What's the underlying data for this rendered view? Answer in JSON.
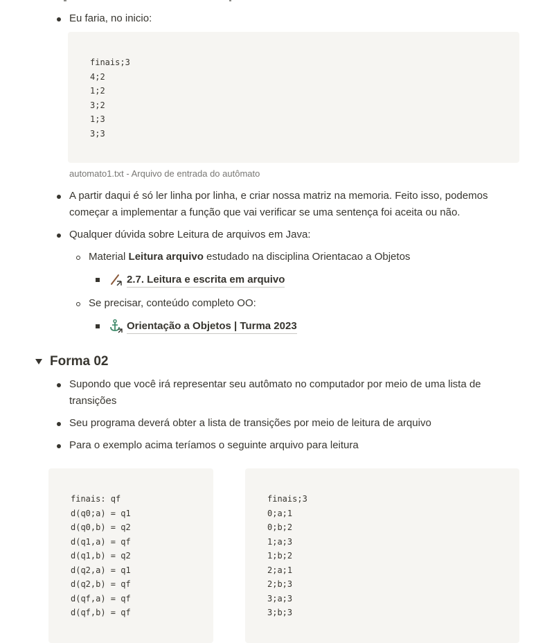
{
  "top_list": {
    "item1": "Eu faria, no inicio:",
    "code1": [
      "finais;3",
      "4;2",
      "1;2",
      "3;2",
      "1;3",
      "3;3"
    ],
    "caption": "automato1.txt - Arquivo de entrada do autômato",
    "item2_line1": "A partir daqui é só ler linha por linha, e criar nossa matriz na memoria. Feito isso, podemos",
    "item2_line2": "começar a implementar a função que vai verificar se uma sentença foi aceita ou não.",
    "item3": "Qualquer dúvida sobre Leitura de arquivos em Java:",
    "sub1_pre": "Material ",
    "sub1_bold": "Leitura arquivo",
    "sub1_post": " estudado na disciplina Orientacao a Objetos",
    "link1": "2.7. Leitura e escrita em arquivo",
    "sub2": "Se precisar, conteúdo completo OO:",
    "link2": "Orientação a Objetos | Turma 2023"
  },
  "section": {
    "title": "Forma 02",
    "item1_line1": "Supondo que você irá representar seu autômato no computador por meio de uma lista de",
    "item1_line2": "transições",
    "item2": "Seu programa deverá obter a lista de transições por meio de leitura de arquivo",
    "item3": "Para o exemplo acima teríamos o seguinte arquivo para leitura",
    "code_left": [
      "finais: qf",
      "d(q0;a) = q1",
      "d(q0,b) = q2",
      "d(q1,a) = qf",
      "d(q1,b) = q2",
      "d(q2,a) = q1",
      "d(q2,b) = qf",
      "d(qf,a) = qf",
      "d(qf,b) = qf"
    ],
    "code_right": [
      "finais;3",
      "0;a;1",
      "0;b;2",
      "1;a;3",
      "1;b;2",
      "2;a;1",
      "2;b;3",
      "3;a;3",
      "3;b;3"
    ]
  },
  "icons": {
    "link1_icon": "pencil-icon",
    "link2_icon": "anchor-icon"
  }
}
